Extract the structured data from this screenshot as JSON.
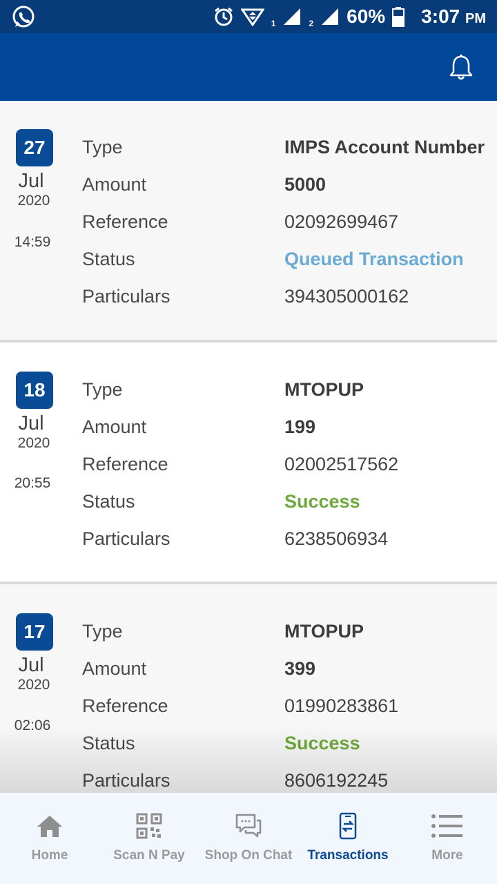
{
  "status_bar": {
    "battery": "60%",
    "time": "3:07",
    "ampm": "PM",
    "sim1": "1",
    "sim2": "2"
  },
  "transactions": [
    {
      "day": "27",
      "month": "Jul",
      "year": "2020",
      "time": "14:59",
      "labels": {
        "type": "Type",
        "amount": "Amount",
        "reference": "Reference",
        "status": "Status",
        "particulars": "Particulars"
      },
      "type": "IMPS Account Number",
      "amount": "5000",
      "reference": "02092699467",
      "status": "Queued Transaction",
      "status_color": "#6aabd6",
      "particulars": "394305000162"
    },
    {
      "day": "18",
      "month": "Jul",
      "year": "2020",
      "time": "20:55",
      "labels": {
        "type": "Type",
        "amount": "Amount",
        "reference": "Reference",
        "status": "Status",
        "particulars": "Particulars"
      },
      "type": "MTOPUP",
      "amount": "199",
      "reference": "02002517562",
      "status": "Success",
      "status_color": "#6fa83c",
      "particulars": "6238506934"
    },
    {
      "day": "17",
      "month": "Jul",
      "year": "2020",
      "time": "02:06",
      "labels": {
        "type": "Type",
        "amount": "Amount",
        "reference": "Reference",
        "status": "Status",
        "particulars": "Particulars"
      },
      "type": "MTOPUP",
      "amount": "399",
      "reference": "01990283861",
      "status": "Success",
      "status_color": "#6fa83c",
      "particulars": "8606192245"
    }
  ],
  "bottom_nav": {
    "items": [
      {
        "label": "Home",
        "icon": "home-icon"
      },
      {
        "label": "Scan N Pay",
        "icon": "qr-code-icon"
      },
      {
        "label": "Shop On Chat",
        "icon": "chat-icon"
      },
      {
        "label": "Transactions",
        "icon": "transactions-icon",
        "active": true
      },
      {
        "label": "More",
        "icon": "menu-icon"
      }
    ]
  },
  "colors": {
    "brand": "#02489a",
    "status_bar": "#073b79",
    "active_nav": "#0b4a93",
    "inactive_nav": "#9a9a9a",
    "date_badge": "#0a4b96"
  }
}
